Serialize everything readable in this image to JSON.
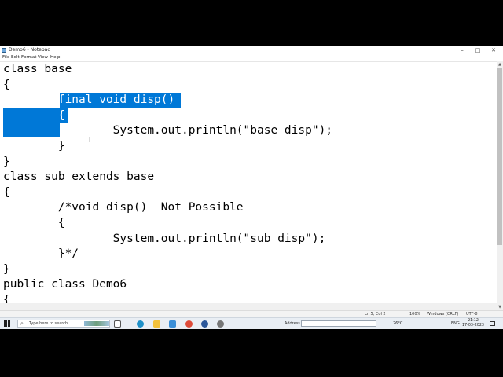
{
  "window": {
    "title": "Demo6 - Notepad",
    "minimize_glyph": "–",
    "maximize_glyph": "□",
    "close_glyph": "✕"
  },
  "menu": [
    "File",
    "Edit",
    "Format",
    "View",
    "Help"
  ],
  "editor": {
    "lines": [
      {
        "pre": "class base",
        "hl": "",
        "post": ""
      },
      {
        "pre": "{",
        "hl": "",
        "post": ""
      },
      {
        "pre": "        ",
        "hl": "final void disp()",
        "post": ""
      },
      {
        "pre": "        ",
        "hl": "{",
        "post": ""
      },
      {
        "pre": "                System.out.println(\"base disp\");",
        "hl": "",
        "post": ""
      },
      {
        "pre": "        }",
        "hl": "",
        "post": ""
      },
      {
        "pre": "}",
        "hl": "",
        "post": ""
      },
      {
        "pre": "class sub extends base",
        "hl": "",
        "post": ""
      },
      {
        "pre": "{",
        "hl": "",
        "post": ""
      },
      {
        "pre": "        /*void disp()  Not Possible",
        "hl": "",
        "post": ""
      },
      {
        "pre": "        {",
        "hl": "",
        "post": ""
      },
      {
        "pre": "                System.out.println(\"sub disp\");",
        "hl": "",
        "post": ""
      },
      {
        "pre": "        }*/",
        "hl": "",
        "post": ""
      },
      {
        "pre": "}",
        "hl": "",
        "post": ""
      },
      {
        "pre": "public class Demo6",
        "hl": "",
        "post": ""
      },
      {
        "pre": "{",
        "hl": "",
        "post": ""
      }
    ],
    "selection_color": "#0078d7",
    "mouse_cursor_glyph": "I"
  },
  "status": {
    "position": "Ln 5, Col 2",
    "zoom": "100%",
    "line_ending": "Windows (CRLF)",
    "encoding": "UTF-8"
  },
  "taskbar": {
    "search_placeholder": "Type here to search",
    "address_label": "Address",
    "weather": "26°C",
    "language": "ENG",
    "time": "21:12",
    "date": "17-03-2023"
  },
  "colors": {
    "accent": "#0078d7",
    "taskbar_bg": "#e9eef4"
  }
}
